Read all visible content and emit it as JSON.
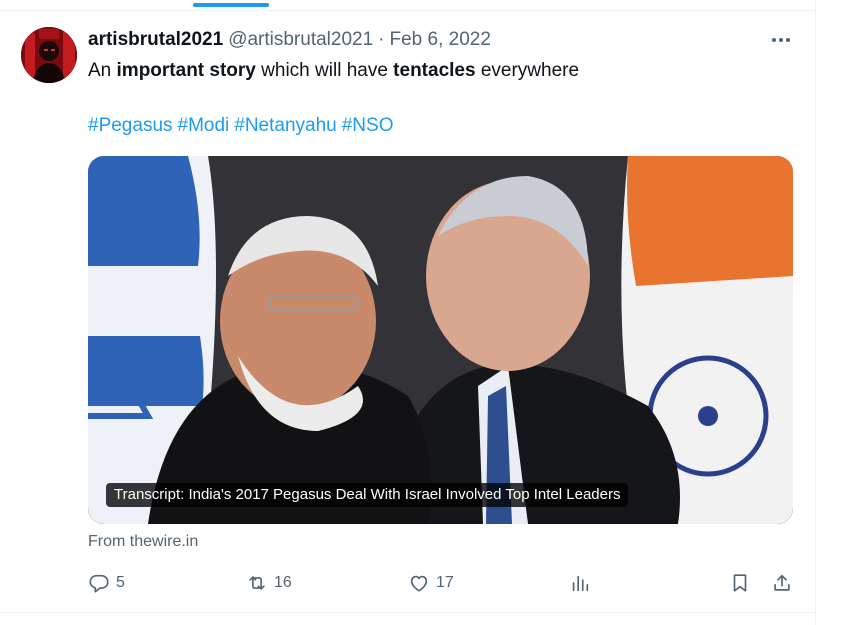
{
  "tweet": {
    "display_name": "artisbrutal2021",
    "handle": "@artisbrutal2021",
    "separator": "·",
    "date": "Feb 6, 2022",
    "text": {
      "p1": "An ",
      "b1": "important story",
      "p2": " which will have ",
      "b2": "tentacles",
      "p3": " everywhere"
    },
    "hashtags": [
      "#Pegasus",
      "#Modi",
      "#Netanyahu",
      "#NSO"
    ]
  },
  "card": {
    "caption": "Transcript: India's 2017 Pegasus Deal With Israel Involved Top Intel Leaders",
    "source": "From thewire.in"
  },
  "actions": {
    "replies": "5",
    "reposts": "16",
    "likes": "17"
  },
  "icons": {
    "more": "more-icon",
    "reply": "reply-icon",
    "repost": "repost-icon",
    "like": "heart-icon",
    "views": "views-icon",
    "bookmark": "bookmark-icon",
    "share": "share-icon"
  },
  "colors": {
    "accent": "#1d9bf0",
    "muted": "#536471",
    "text": "#0f1419"
  }
}
